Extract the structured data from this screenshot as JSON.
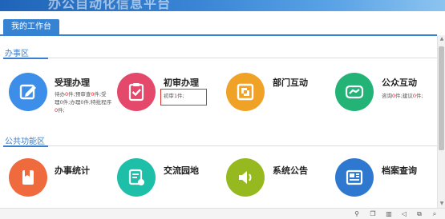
{
  "header": {
    "title": "办公自动化信息平台"
  },
  "tabs": {
    "active": "我的工作台"
  },
  "sections": {
    "office": "办事区",
    "public": "公共功能区"
  },
  "cards": [
    {
      "title": "受理办理",
      "color": "#3d8ee8",
      "stats_l1_a": "待办",
      "stats_l1_n1": "0",
      "stats_l1_b": "件;预审查",
      "stats_l1_n2": "0",
      "stats_l1_c": "件;受",
      "stats_l2_a": "理",
      "stats_l2_n1": "0",
      "stats_l2_b": "件;办理",
      "stats_l2_n2": "0",
      "stats_l2_c": "件;特批程序",
      "stats_l3_n": "0",
      "stats_l3_b": "件;"
    },
    {
      "title": "初审办理",
      "color": "#e4486a",
      "stats_a": "初审",
      "stats_n": "1",
      "stats_b": "件;"
    },
    {
      "title": "部门互动",
      "color": "#f0a227"
    },
    {
      "title": "公众互动",
      "color": "#24b377",
      "stats_a": "咨询",
      "stats_n1": "0",
      "stats_b": "件;建议",
      "stats_n2": "0",
      "stats_c": "件;"
    },
    {
      "title": "办事统计",
      "color": "#ef6a3d"
    },
    {
      "title": "交流园地",
      "color": "#1ebfa8"
    },
    {
      "title": "系统公告",
      "color": "#95b91f"
    },
    {
      "title": "档案查询",
      "color": "#2e79cf"
    }
  ],
  "status_icons": [
    "pin-icon",
    "window-icon",
    "trash-icon",
    "sound-icon",
    "duplicate-icon",
    "zoom-icon"
  ]
}
